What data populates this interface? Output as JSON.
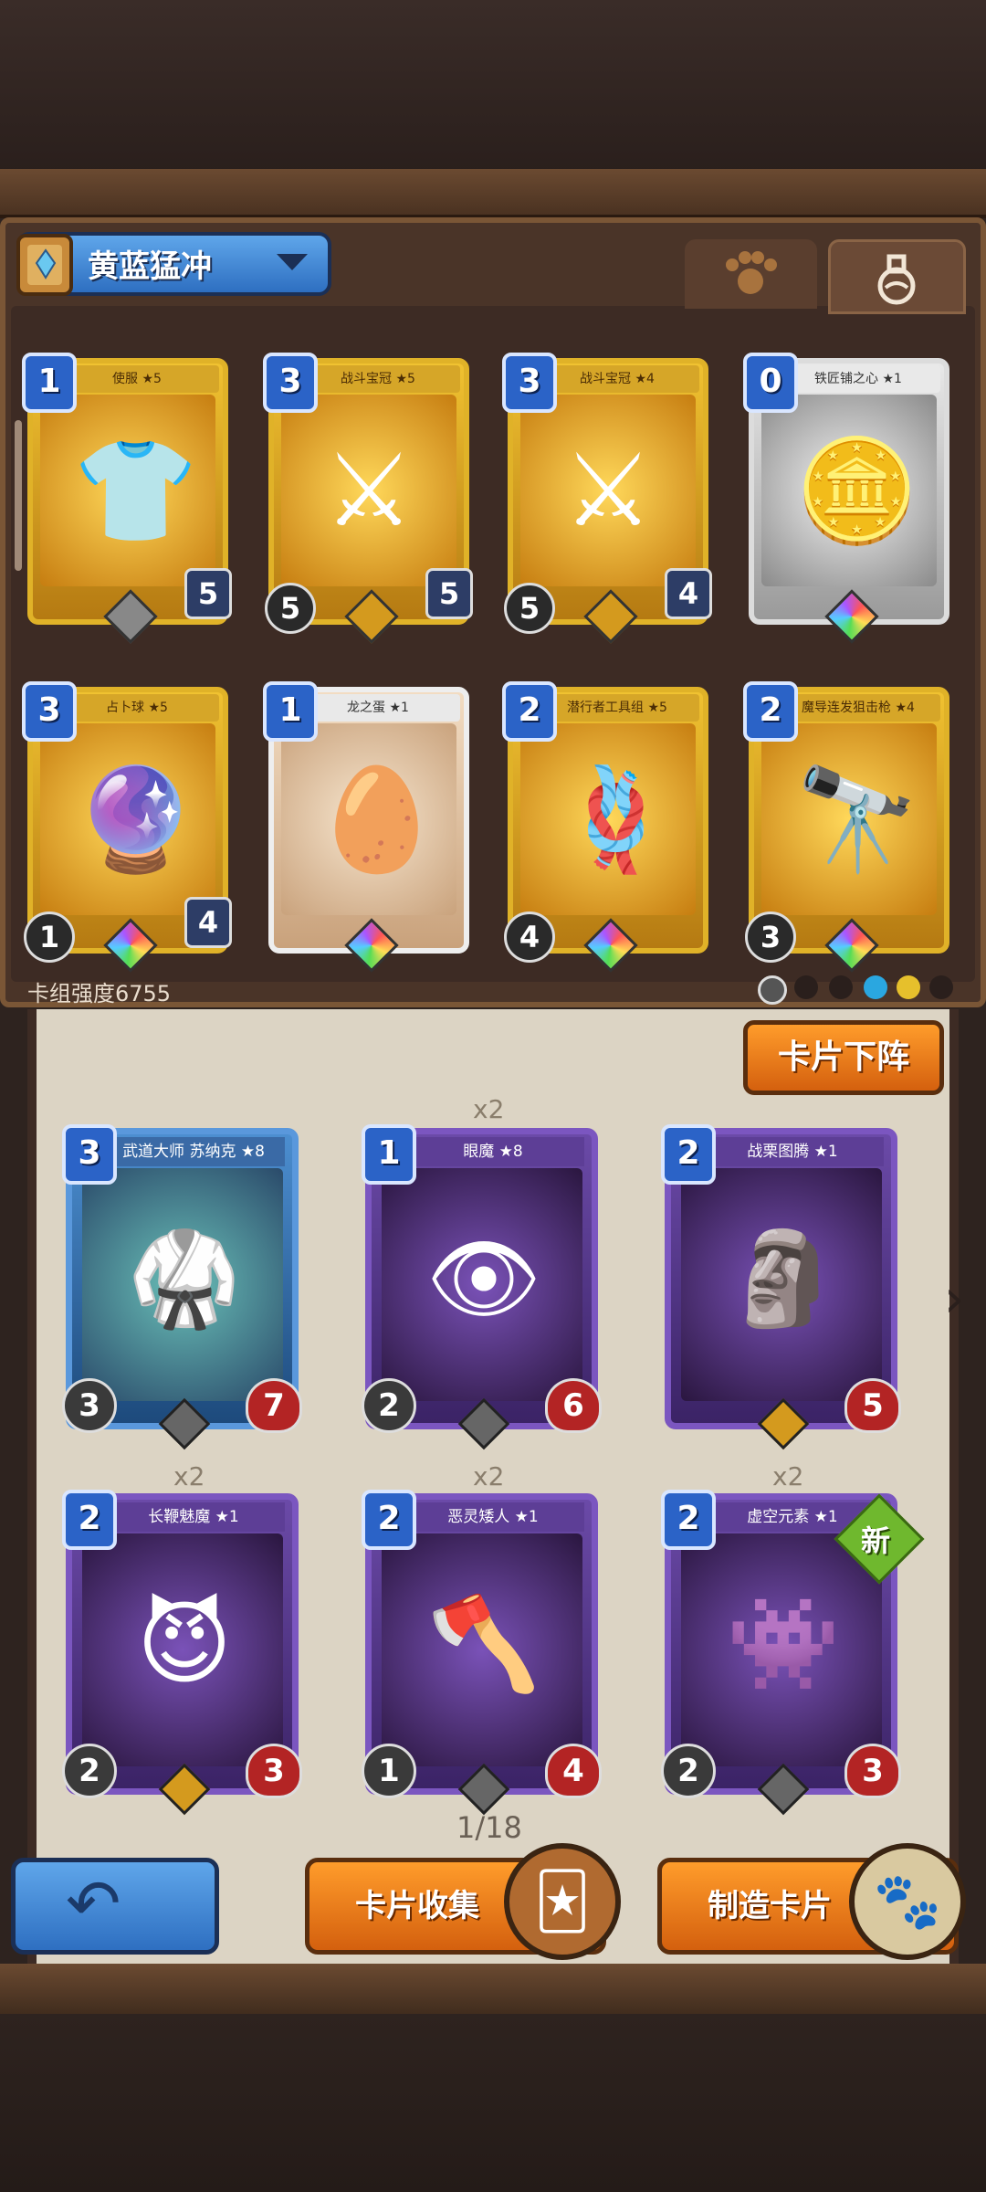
{
  "deck": {
    "name": "黄蓝猛冲",
    "strength": "卡组强度6755",
    "tabs": [
      "paw-tab",
      "potion-tab"
    ]
  },
  "deck_cards": [
    {
      "cost": "1",
      "name": "使服 ★5",
      "left": "",
      "right": "5",
      "art": "👕",
      "style": "gold",
      "gem": "gray"
    },
    {
      "cost": "3",
      "name": "战斗宝冠 ★5",
      "left": "5",
      "right": "5",
      "art": "⚔",
      "style": "gold",
      "gem": "gold"
    },
    {
      "cost": "3",
      "name": "战斗宝冠 ★4",
      "left": "5",
      "right": "4",
      "art": "⚔",
      "style": "gold",
      "gem": "gold"
    },
    {
      "cost": "0",
      "name": "铁匠铺之心 ★1",
      "left": "",
      "right": "",
      "art": "🪙",
      "style": "silver",
      "gem": "rainbow"
    },
    {
      "cost": "3",
      "name": "占卜球 ★5",
      "left": "1",
      "right": "4",
      "art": "🔮",
      "style": "gold",
      "gem": "rainbow"
    },
    {
      "cost": "1",
      "name": "龙之蛋 ★1",
      "left": "",
      "right": "",
      "art": "🥚",
      "style": "tan",
      "gem": "rainbow"
    },
    {
      "cost": "2",
      "name": "潜行者工具组 ★5",
      "left": "4",
      "right": "",
      "art": "🪢",
      "style": "gold",
      "gem": "rainbow"
    },
    {
      "cost": "2",
      "name": "魔导连发狙击枪 ★4",
      "left": "3",
      "right": "",
      "art": "🔭",
      "style": "gold",
      "gem": "rainbow"
    }
  ],
  "collection": {
    "remove_button": "卡片下阵",
    "page": "1/18",
    "cards": [
      {
        "cost": "3",
        "name": "武道大师 苏纳克 ★8",
        "atk": "3",
        "hp": "7",
        "count": "",
        "art": "🥋",
        "style": "blue",
        "gem": "gray"
      },
      {
        "cost": "1",
        "name": "眼魔 ★8",
        "atk": "2",
        "hp": "6",
        "count": "x2",
        "art": "👁",
        "style": "purple",
        "gem": "gray"
      },
      {
        "cost": "2",
        "name": "战栗图腾 ★1",
        "atk": "",
        "hp": "5",
        "count": "",
        "art": "🗿",
        "style": "purple",
        "gem": "gold"
      },
      {
        "cost": "2",
        "name": "长鞭魅魔 ★1",
        "atk": "2",
        "hp": "3",
        "count": "x2",
        "art": "😈",
        "style": "purple",
        "gem": "gold"
      },
      {
        "cost": "2",
        "name": "恶灵矮人 ★1",
        "atk": "1",
        "hp": "4",
        "count": "x2",
        "art": "🪓",
        "style": "purple",
        "gem": "gray"
      },
      {
        "cost": "2",
        "name": "虚空元素 ★1",
        "atk": "2",
        "hp": "3",
        "count": "x2",
        "art": "👾",
        "style": "purple",
        "gem": "gray"
      }
    ],
    "new_badge": "新"
  },
  "bottom": {
    "collect_label": "卡片收集",
    "craft_label": "制造卡片"
  }
}
